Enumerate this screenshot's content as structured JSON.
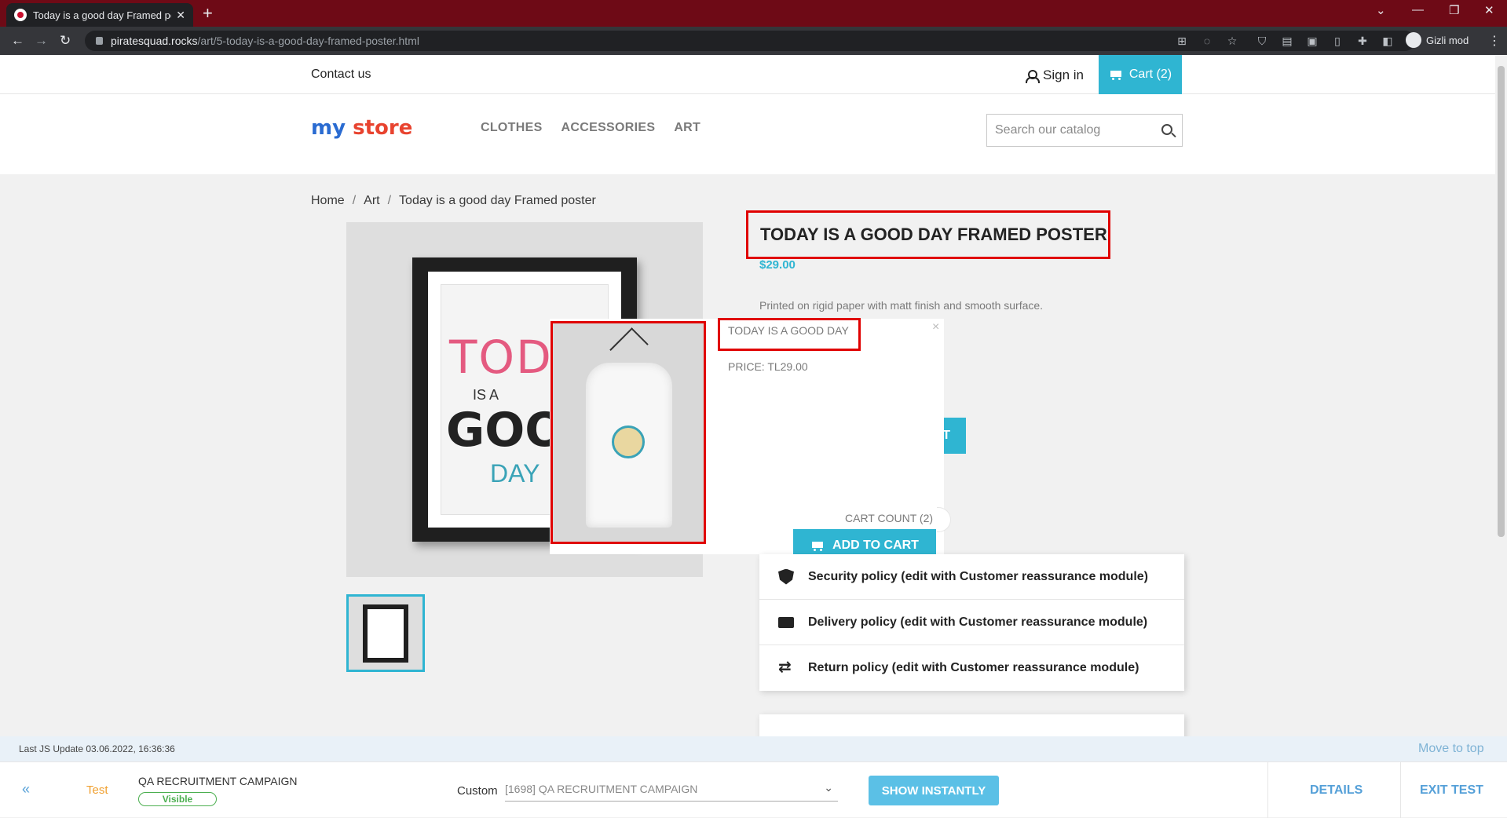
{
  "browser": {
    "tab_title": "Today is a good day Framed post",
    "url_host": "piratesquad.rocks",
    "url_path": "/art/5-today-is-a-good-day-framed-poster.html",
    "profile_label": "Gizli mod"
  },
  "store": {
    "contact": "Contact us",
    "sign_in": "Sign in",
    "cart": "Cart (2)",
    "logo_part1": "my",
    "logo_part2": "store",
    "nav": [
      "CLOTHES",
      "ACCESSORIES",
      "ART"
    ],
    "search_placeholder": "Search our catalog"
  },
  "breadcrumb": [
    "Home",
    "Art",
    "Today is a good day Framed poster"
  ],
  "product": {
    "title": "TODAY IS A GOOD DAY FRAMED POSTER",
    "price": "$29.00",
    "description": "Printed on rigid paper with matt finish and smooth surface.",
    "poster_text": [
      "TODA",
      "IS A",
      "GOO",
      "DAY"
    ],
    "partial_button": "T"
  },
  "popup": {
    "name": "TODAY IS A GOOD DAY",
    "price": "PRICE: TL29.00",
    "cart_count": "CART COUNT (2)",
    "add_to_cart": "ADD TO CART",
    "close": "×"
  },
  "reassurance": [
    {
      "icon": "shield-icon",
      "label": "Security policy (edit with Customer reassurance module)"
    },
    {
      "icon": "truck-icon",
      "label": "Delivery policy (edit with Customer reassurance module)"
    },
    {
      "icon": "swap-icon",
      "label": "Return policy (edit with Customer reassurance module)"
    }
  ],
  "qa_panel": {
    "last_update": "Last JS Update 03.06.2022, 16:36:36",
    "move_to_top": "Move to top",
    "collapse": "«",
    "test_label": "Test",
    "campaign": "QA RECRUITMENT CAMPAIGN",
    "visible_badge": "Visible",
    "custom_label": "Custom",
    "campaign_select": "[1698] QA RECRUITMENT CAMPAIGN",
    "show_instantly": "SHOW INSTANTLY",
    "details": "DETAILS",
    "exit_test": "EXIT TEST"
  },
  "colors": {
    "accent": "#2fb5d2",
    "highlight_border": "#e00000",
    "chrome_tab_bar": "#6e0a16"
  }
}
